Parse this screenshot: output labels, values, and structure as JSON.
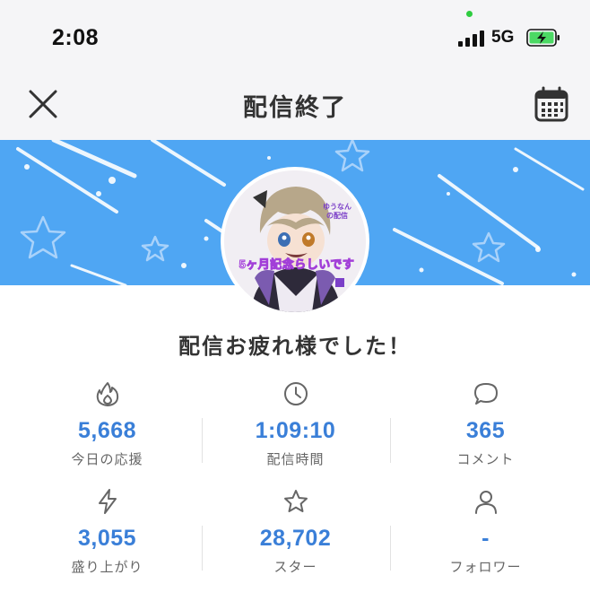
{
  "status_bar": {
    "time": "2:08",
    "network": "5G",
    "battery_color": "#4cd964"
  },
  "nav": {
    "title": "配信終了"
  },
  "banner": {
    "color": "#4fa6f3",
    "avatar_caption": "5ヶ月記念らしいです",
    "avatar_small_text": "ゆうなん の配信"
  },
  "message": "配信お疲れ様でした！",
  "stats": [
    {
      "icon": "flame-icon",
      "value": "5,668",
      "label": "今日の応援"
    },
    {
      "icon": "clock-icon",
      "value": "1:09:10",
      "label": "配信時間"
    },
    {
      "icon": "comment-icon",
      "value": "365",
      "label": "コメント"
    },
    {
      "icon": "lightning-icon",
      "value": "3,055",
      "label": "盛り上がり"
    },
    {
      "icon": "star-icon",
      "value": "28,702",
      "label": "スター"
    },
    {
      "icon": "person-icon",
      "value": "-",
      "label": "フォロワー"
    }
  ],
  "colors": {
    "value": "#3a7fd8",
    "icon": "#666666",
    "header_bg": "#f5f5f7"
  }
}
